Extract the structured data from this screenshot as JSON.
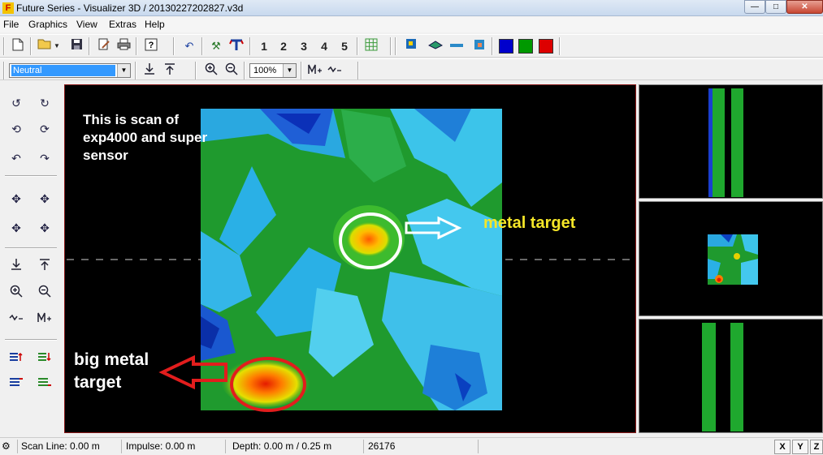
{
  "window": {
    "title": "Future Series - Visualizer 3D / 20130227202827.v3d",
    "minimize": "—",
    "maximize": "□",
    "close": "✕"
  },
  "menu": [
    "File",
    "Graphics",
    "View",
    "Extras",
    "Help"
  ],
  "toolbar": {
    "numbers": [
      "1",
      "2",
      "3",
      "4",
      "5"
    ],
    "colors": {
      "blue": "#0000cc",
      "green": "#009900",
      "red": "#dd0000"
    }
  },
  "toolbar2": {
    "color_preset": "Neutral",
    "zoom": "100%"
  },
  "annotations": {
    "scan_note": [
      "This is scan of",
      "exp4000 and super",
      "sensor"
    ],
    "metal_target": "metal target",
    "big_metal_target": [
      "big metal",
      "target"
    ]
  },
  "status": {
    "scan_line": "Scan Line: 0.00 m",
    "impulse": "Impulse: 0.00 m",
    "depth": "Depth: 0.00 m / 0.25 m",
    "value": "26176",
    "axes": [
      "X",
      "Y",
      "Z"
    ]
  }
}
